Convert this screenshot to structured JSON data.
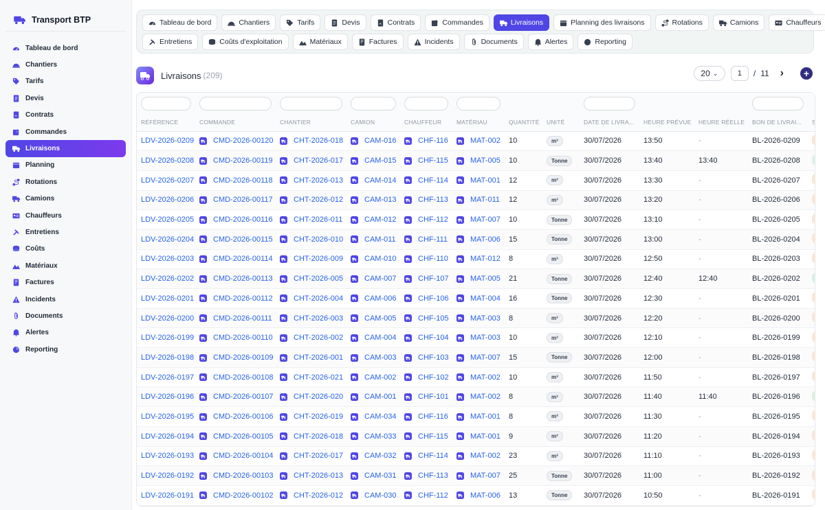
{
  "app": {
    "title": "Transport BTP",
    "logo_icon": "truck-icon"
  },
  "colors": {
    "accent": "#4f46e5",
    "link": "#2563eb"
  },
  "sidebar": {
    "items": [
      {
        "label": "Tableau de bord",
        "icon": "dashboard-icon",
        "active": false
      },
      {
        "label": "Chantiers",
        "icon": "helmet-icon",
        "active": false
      },
      {
        "label": "Tarifs",
        "icon": "tag-icon",
        "active": false
      },
      {
        "label": "Devis",
        "icon": "document-icon",
        "active": false
      },
      {
        "label": "Contrats",
        "icon": "contract-icon",
        "active": false
      },
      {
        "label": "Commandes",
        "icon": "order-icon",
        "active": false
      },
      {
        "label": "Livraisons",
        "icon": "delivery-icon",
        "active": true
      },
      {
        "label": "Planning",
        "icon": "calendar-icon",
        "active": false
      },
      {
        "label": "Rotations",
        "icon": "route-icon",
        "active": false
      },
      {
        "label": "Camions",
        "icon": "truck-icon",
        "active": false
      },
      {
        "label": "Chauffeurs",
        "icon": "id-card-icon",
        "active": false
      },
      {
        "label": "Entretiens",
        "icon": "wrench-icon",
        "active": false
      },
      {
        "label": "Coûts",
        "icon": "coins-icon",
        "active": false
      },
      {
        "label": "Matériaux",
        "icon": "materials-icon",
        "active": false
      },
      {
        "label": "Factures",
        "icon": "invoice-icon",
        "active": false
      },
      {
        "label": "Incidents",
        "icon": "warning-icon",
        "active": false
      },
      {
        "label": "Documents",
        "icon": "paperclip-icon",
        "active": false
      },
      {
        "label": "Alertes",
        "icon": "bell-icon",
        "active": false
      },
      {
        "label": "Reporting",
        "icon": "pie-chart-icon",
        "active": false
      }
    ]
  },
  "tabs": {
    "row1": [
      {
        "label": "Tableau de bord",
        "icon": "dashboard-icon",
        "active": false
      },
      {
        "label": "Chantiers",
        "icon": "helmet-icon",
        "active": false
      },
      {
        "label": "Tarifs",
        "icon": "tag-icon",
        "active": false
      },
      {
        "label": "Devis",
        "icon": "document-icon",
        "active": false
      },
      {
        "label": "Contrats",
        "icon": "contract-icon",
        "active": false
      },
      {
        "label": "Commandes",
        "icon": "order-icon",
        "active": false
      },
      {
        "label": "Livraisons",
        "icon": "delivery-icon",
        "active": true
      },
      {
        "label": "Planning des livraisons",
        "icon": "calendar-icon",
        "active": false
      },
      {
        "label": "Rotations",
        "icon": "route-icon",
        "active": false
      },
      {
        "label": "Camions",
        "icon": "truck-icon",
        "active": false
      },
      {
        "label": "Chauffeurs",
        "icon": "id-card-icon",
        "active": false
      }
    ],
    "row2": [
      {
        "label": "Entretiens",
        "icon": "wrench-icon",
        "active": false
      },
      {
        "label": "Coûts d'exploitation",
        "icon": "coins-icon",
        "active": false
      },
      {
        "label": "Matériaux",
        "icon": "materials-icon",
        "active": false
      },
      {
        "label": "Factures",
        "icon": "invoice-icon",
        "active": false
      },
      {
        "label": "Incidents",
        "icon": "warning-icon",
        "active": false
      },
      {
        "label": "Documents",
        "icon": "paperclip-icon",
        "active": false
      },
      {
        "label": "Alertes",
        "icon": "bell-icon",
        "active": false
      },
      {
        "label": "Reporting",
        "icon": "pie-chart-icon",
        "active": false
      }
    ]
  },
  "page": {
    "title": "Livraisons",
    "count": "(209)"
  },
  "pager": {
    "page_size": "20",
    "current_page": "1",
    "separator": "/",
    "total_pages": "11",
    "next": "›",
    "add": "+"
  },
  "table": {
    "columns": [
      "RÉFÉRENCE",
      "COMMANDE",
      "CHANTIER",
      "CAMION",
      "CHAUFFEUR",
      "MATÉRIAU",
      "QUANTITÉ",
      "UNITÉ",
      "DATE DE LIVRA...",
      "HEURE PRÉVUE",
      "HEURE RÉELLE",
      "BON DE LIVRAI...",
      "S"
    ],
    "rows": [
      [
        "LDV-2026-0209",
        "CMD-2026-00120",
        "CHT-2026-018",
        "CAM-016",
        "CHF-116",
        "MAT-002",
        "10",
        "m³",
        "30/07/2026",
        "13:50",
        "-",
        "BL-2026-0209",
        "o"
      ],
      [
        "LDV-2026-0208",
        "CMD-2026-00119",
        "CHT-2026-017",
        "CAM-015",
        "CHF-115",
        "MAT-005",
        "10",
        "Tonne",
        "30/07/2026",
        "13:40",
        "13:40",
        "BL-2026-0208",
        "g"
      ],
      [
        "LDV-2026-0207",
        "CMD-2026-00118",
        "CHT-2026-013",
        "CAM-014",
        "CHF-114",
        "MAT-001",
        "12",
        "m³",
        "30/07/2026",
        "13:30",
        "-",
        "BL-2026-0207",
        "o"
      ],
      [
        "LDV-2026-0206",
        "CMD-2026-00117",
        "CHT-2026-012",
        "CAM-013",
        "CHF-113",
        "MAT-011",
        "12",
        "m³",
        "30/07/2026",
        "13:20",
        "-",
        "BL-2026-0206",
        "o"
      ],
      [
        "LDV-2026-0205",
        "CMD-2026-00116",
        "CHT-2026-011",
        "CAM-012",
        "CHF-112",
        "MAT-007",
        "10",
        "Tonne",
        "30/07/2026",
        "13:10",
        "-",
        "BL-2026-0205",
        "o"
      ],
      [
        "LDV-2026-0204",
        "CMD-2026-00115",
        "CHT-2026-010",
        "CAM-011",
        "CHF-111",
        "MAT-006",
        "15",
        "Tonne",
        "30/07/2026",
        "13:00",
        "-",
        "BL-2026-0204",
        "o"
      ],
      [
        "LDV-2026-0203",
        "CMD-2026-00114",
        "CHT-2026-009",
        "CAM-010",
        "CHF-110",
        "MAT-012",
        "8",
        "m³",
        "30/07/2026",
        "12:50",
        "-",
        "BL-2026-0203",
        "o"
      ],
      [
        "LDV-2026-0202",
        "CMD-2026-00113",
        "CHT-2026-005",
        "CAM-007",
        "CHF-107",
        "MAT-005",
        "21",
        "Tonne",
        "30/07/2026",
        "12:40",
        "12:40",
        "BL-2026-0202",
        "g"
      ],
      [
        "LDV-2026-0201",
        "CMD-2026-00112",
        "CHT-2026-004",
        "CAM-006",
        "CHF-106",
        "MAT-004",
        "16",
        "Tonne",
        "30/07/2026",
        "12:30",
        "-",
        "BL-2026-0201",
        "o"
      ],
      [
        "LDV-2026-0200",
        "CMD-2026-00111",
        "CHT-2026-003",
        "CAM-005",
        "CHF-105",
        "MAT-003",
        "8",
        "m³",
        "30/07/2026",
        "12:20",
        "-",
        "BL-2026-0200",
        "o"
      ],
      [
        "LDV-2026-0199",
        "CMD-2026-00110",
        "CHT-2026-002",
        "CAM-004",
        "CHF-104",
        "MAT-003",
        "10",
        "m³",
        "30/07/2026",
        "12:10",
        "-",
        "BL-2026-0199",
        "o"
      ],
      [
        "LDV-2026-0198",
        "CMD-2026-00109",
        "CHT-2026-001",
        "CAM-003",
        "CHF-103",
        "MAT-007",
        "15",
        "Tonne",
        "30/07/2026",
        "12:00",
        "-",
        "BL-2026-0198",
        "o"
      ],
      [
        "LDV-2026-0197",
        "CMD-2026-00108",
        "CHT-2026-021",
        "CAM-002",
        "CHF-102",
        "MAT-002",
        "10",
        "m³",
        "30/07/2026",
        "11:50",
        "-",
        "BL-2026-0197",
        "o"
      ],
      [
        "LDV-2026-0196",
        "CMD-2026-00107",
        "CHT-2026-020",
        "CAM-001",
        "CHF-101",
        "MAT-002",
        "8",
        "m³",
        "30/07/2026",
        "11:40",
        "11:40",
        "BL-2026-0196",
        "g"
      ],
      [
        "LDV-2026-0195",
        "CMD-2026-00106",
        "CHT-2026-019",
        "CAM-034",
        "CHF-116",
        "MAT-001",
        "8",
        "m³",
        "30/07/2026",
        "11:30",
        "-",
        "BL-2026-0195",
        "o"
      ],
      [
        "LDV-2026-0194",
        "CMD-2026-00105",
        "CHT-2026-018",
        "CAM-033",
        "CHF-115",
        "MAT-001",
        "9",
        "m³",
        "30/07/2026",
        "11:20",
        "-",
        "BL-2026-0194",
        "o"
      ],
      [
        "LDV-2026-0193",
        "CMD-2026-00104",
        "CHT-2026-017",
        "CAM-032",
        "CHF-114",
        "MAT-002",
        "23",
        "m³",
        "30/07/2026",
        "11:10",
        "-",
        "BL-2026-0193",
        "o"
      ],
      [
        "LDV-2026-0192",
        "CMD-2026-00103",
        "CHT-2026-013",
        "CAM-031",
        "CHF-113",
        "MAT-007",
        "25",
        "Tonne",
        "30/07/2026",
        "11:00",
        "-",
        "BL-2026-0192",
        "o"
      ],
      [
        "LDV-2026-0191",
        "CMD-2026-00102",
        "CHT-2026-012",
        "CAM-030",
        "CHF-112",
        "MAT-006",
        "13",
        "Tonne",
        "30/07/2026",
        "10:50",
        "-",
        "BL-2026-0191",
        "o"
      ]
    ]
  }
}
